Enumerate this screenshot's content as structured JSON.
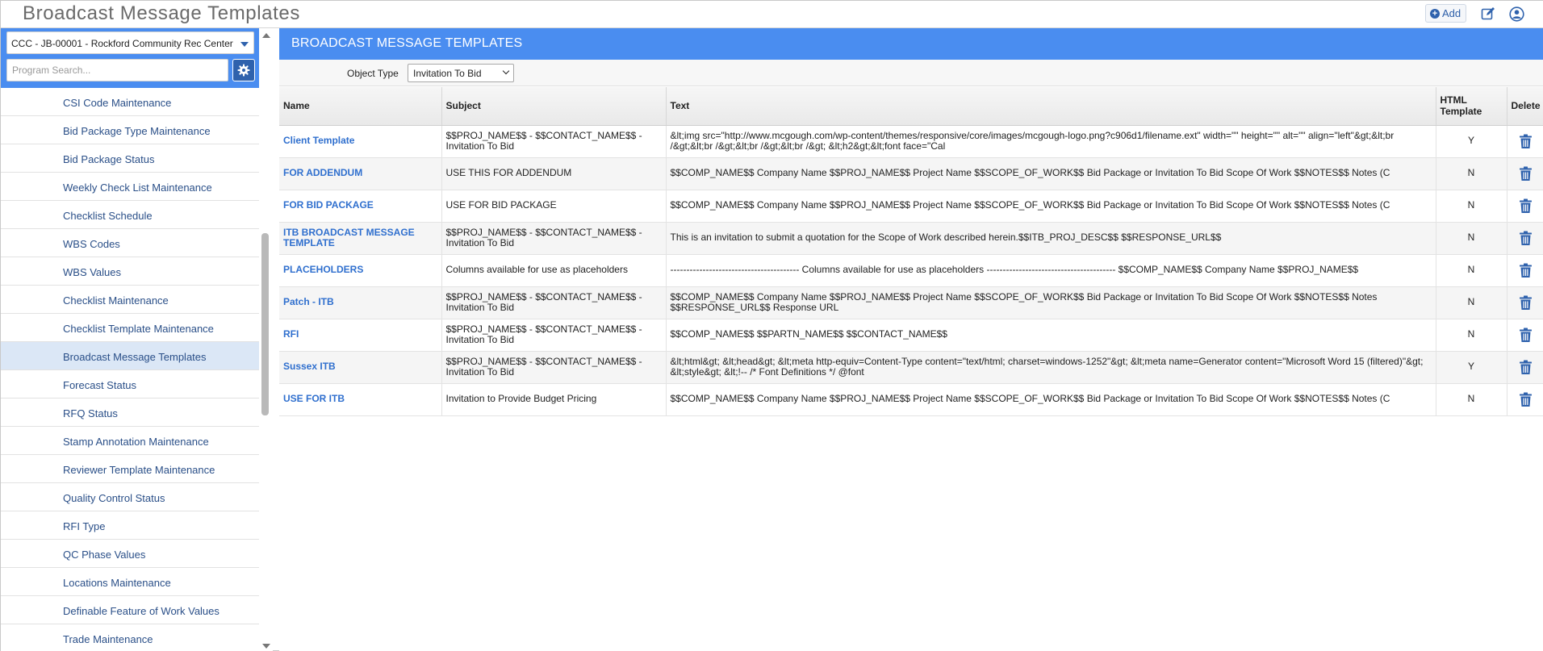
{
  "app": {
    "title": "Broadcast Message Templates",
    "add_label": "Add"
  },
  "sidebar": {
    "project": "CCC - JB-00001 - Rockford Community Rec Center",
    "search_placeholder": "Program Search...",
    "items": [
      "CSI Code Maintenance",
      "Bid Package Type Maintenance",
      "Bid Package Status",
      "Weekly Check List Maintenance",
      "Checklist Schedule",
      "WBS Codes",
      "WBS Values",
      "Checklist Maintenance",
      "Checklist Template Maintenance",
      "Broadcast Message Templates",
      "Forecast Status",
      "RFQ Status",
      "Stamp Annotation Maintenance",
      "Reviewer Template Maintenance",
      "Quality Control Status",
      "RFI Type",
      "QC Phase Values",
      "Locations Maintenance",
      "Definable Feature of Work Values",
      "Trade Maintenance"
    ],
    "active_index": 9
  },
  "main": {
    "header": "BROADCAST MESSAGE TEMPLATES",
    "filter": {
      "label": "Object Type",
      "value": "Invitation To Bid"
    },
    "columns": {
      "name": "Name",
      "subject": "Subject",
      "text": "Text",
      "html": "HTML Template",
      "delete": "Delete"
    },
    "rows": [
      {
        "name": "Client Template",
        "subject": "$$PROJ_NAME$$ - $$CONTACT_NAME$$ - Invitation To Bid",
        "text": "&lt;img src=\"http://www.mcgough.com/wp-content/themes/responsive/core/images/mcgough-logo.png?c906d1/filename.ext\" width=\"\" height=\"\" alt=\"\" align=\"left\"&gt;&lt;br /&gt;&lt;br /&gt;&lt;br /&gt;&lt;br /&gt; &lt;h2&gt;&lt;font face=\"Cal",
        "html": "Y"
      },
      {
        "name": "FOR ADDENDUM",
        "subject": "USE THIS FOR ADDENDUM",
        "text": "$$COMP_NAME$$ Company Name $$PROJ_NAME$$ Project Name $$SCOPE_OF_WORK$$ Bid Package or Invitation To Bid Scope Of Work $$NOTES$$ Notes (C",
        "html": "N"
      },
      {
        "name": "FOR BID PACKAGE",
        "subject": "USE FOR BID PACKAGE",
        "text": "$$COMP_NAME$$ Company Name $$PROJ_NAME$$ Project Name $$SCOPE_OF_WORK$$ Bid Package or Invitation To Bid Scope Of Work $$NOTES$$ Notes (C",
        "html": "N"
      },
      {
        "name": "ITB BROADCAST MESSAGE TEMPLATE",
        "subject": "$$PROJ_NAME$$ - $$CONTACT_NAME$$ - Invitation To Bid",
        "text": "This is an invitation to submit a quotation for the Scope of Work described herein.$$ITB_PROJ_DESC$$ $$RESPONSE_URL$$",
        "html": "N"
      },
      {
        "name": "PLACEHOLDERS",
        "subject": "Columns available for use as placeholders",
        "text": "---------------------------------------- Columns available for use as placeholders ---------------------------------------- $$COMP_NAME$$ Company Name $$PROJ_NAME$$",
        "html": "N"
      },
      {
        "name": "Patch - ITB",
        "subject": "$$PROJ_NAME$$ - $$CONTACT_NAME$$ - Invitation To Bid",
        "text": "$$COMP_NAME$$ Company Name $$PROJ_NAME$$ Project Name $$SCOPE_OF_WORK$$ Bid Package or Invitation To Bid Scope Of Work $$NOTES$$ Notes $$RESPONSE_URL$$ Response URL",
        "html": "N"
      },
      {
        "name": "RFI",
        "subject": "$$PROJ_NAME$$ - $$CONTACT_NAME$$ - Invitation To Bid",
        "text": "$$COMP_NAME$$ $$PARTN_NAME$$ $$CONTACT_NAME$$",
        "html": "N"
      },
      {
        "name": "Sussex ITB",
        "subject": "$$PROJ_NAME$$ - $$CONTACT_NAME$$ - Invitation To Bid",
        "text": "&lt;html&gt; &lt;head&gt; &lt;meta http-equiv=Content-Type content=\"text/html; charset=windows-1252\"&gt; &lt;meta name=Generator content=\"Microsoft Word 15 (filtered)\"&gt; &lt;style&gt; &lt;!-- /* Font Definitions */ @font",
        "html": "Y"
      },
      {
        "name": "USE FOR ITB",
        "subject": "Invitation to Provide Budget Pricing",
        "text": "$$COMP_NAME$$ Company Name $$PROJ_NAME$$ Project Name $$SCOPE_OF_WORK$$ Bid Package or Invitation To Bid Scope Of Work $$NOTES$$ Notes (C",
        "html": "N"
      }
    ]
  },
  "colors": {
    "accent": "#4a8df0",
    "link": "#2f6fce",
    "nav_text": "#2a4f88",
    "trash": "#2f62ad"
  }
}
